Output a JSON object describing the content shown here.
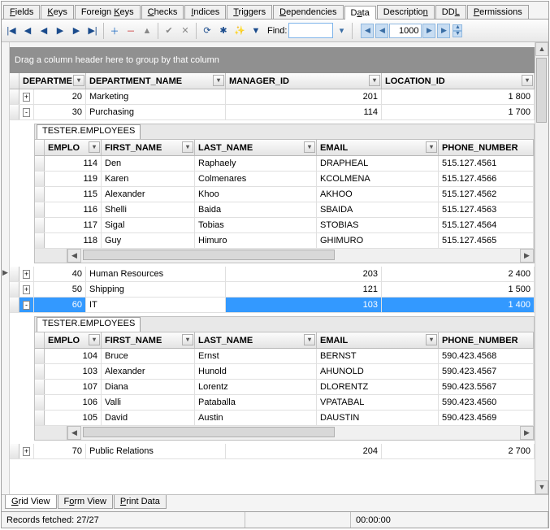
{
  "tabs": [
    "Fields",
    "Keys",
    "Foreign Keys",
    "Checks",
    "Indices",
    "Triggers",
    "Dependencies",
    "Data",
    "Description",
    "DDL",
    "Permissions"
  ],
  "active_tab": "Data",
  "toolbar": {
    "find_label": "Find:"
  },
  "nav": {
    "page_size": "1000"
  },
  "group_hint": "Drag a column header here to group by that column",
  "master": {
    "headers": [
      "DEPARTME",
      "DEPARTMENT_NAME",
      "MANAGER_ID",
      "LOCATION_ID"
    ],
    "rows": [
      {
        "expand": "+",
        "id": "20",
        "name": "Marketing",
        "manager": "201",
        "loc": "1 800",
        "selected": false,
        "expanded": false
      },
      {
        "expand": "-",
        "id": "30",
        "name": "Purchasing",
        "manager": "114",
        "loc": "1 700",
        "selected": false,
        "expanded": true
      },
      {
        "expand": "+",
        "id": "40",
        "name": "Human Resources",
        "manager": "203",
        "loc": "2 400",
        "selected": false,
        "expanded": false
      },
      {
        "expand": "+",
        "id": "50",
        "name": "Shipping",
        "manager": "121",
        "loc": "1 500",
        "selected": false,
        "expanded": false
      },
      {
        "expand": "-",
        "id": "60",
        "name": "IT",
        "manager": "103",
        "loc": "1 400",
        "selected": true,
        "expanded": true
      },
      {
        "expand": "+",
        "id": "70",
        "name": "Public Relations",
        "manager": "204",
        "loc": "2 700",
        "selected": false,
        "expanded": false
      }
    ]
  },
  "nested": {
    "tab_label": "TESTER.EMPLOYEES",
    "headers": [
      "EMPLO",
      "FIRST_NAME",
      "LAST_NAME",
      "EMAIL",
      "PHONE_NUMBER"
    ],
    "dept30": [
      {
        "id": "114",
        "first": "Den",
        "last": "Raphaely",
        "email": "DRAPHEAL",
        "phone": "515.127.4561"
      },
      {
        "id": "119",
        "first": "Karen",
        "last": "Colmenares",
        "email": "KCOLMENA",
        "phone": "515.127.4566"
      },
      {
        "id": "115",
        "first": "Alexander",
        "last": "Khoo",
        "email": "AKHOO",
        "phone": "515.127.4562"
      },
      {
        "id": "116",
        "first": "Shelli",
        "last": "Baida",
        "email": "SBAIDA",
        "phone": "515.127.4563"
      },
      {
        "id": "117",
        "first": "Sigal",
        "last": "Tobias",
        "email": "STOBIAS",
        "phone": "515.127.4564"
      },
      {
        "id": "118",
        "first": "Guy",
        "last": "Himuro",
        "email": "GHIMURO",
        "phone": "515.127.4565"
      }
    ],
    "dept60": [
      {
        "id": "104",
        "first": "Bruce",
        "last": "Ernst",
        "email": "BERNST",
        "phone": "590.423.4568"
      },
      {
        "id": "103",
        "first": "Alexander",
        "last": "Hunold",
        "email": "AHUNOLD",
        "phone": "590.423.4567"
      },
      {
        "id": "107",
        "first": "Diana",
        "last": "Lorentz",
        "email": "DLORENTZ",
        "phone": "590.423.5567"
      },
      {
        "id": "106",
        "first": "Valli",
        "last": "Pataballa",
        "email": "VPATABAL",
        "phone": "590.423.4560"
      },
      {
        "id": "105",
        "first": "David",
        "last": "Austin",
        "email": "DAUSTIN",
        "phone": "590.423.4569"
      }
    ]
  },
  "bottom_tabs": [
    "Grid View",
    "Form View",
    "Print Data"
  ],
  "bottom_active": "Grid View",
  "status": {
    "records": "Records fetched: 27/27",
    "time": "00:00:00"
  },
  "icons": {
    "first": "|◀",
    "prev": "◀",
    "pp": "◀",
    "next": "▶",
    "nn": "▶",
    "last": "▶|",
    "plus": "＋",
    "minus": "－",
    "sep": "▲",
    "check": "✔",
    "x": "✕",
    "refresh": "⟳",
    "star": "✱",
    "wand": "✨",
    "filter": "▼",
    "dd": "▾",
    "navfirst": "◀",
    "navlast": "▶",
    "up": "▲",
    "dn": "▼"
  }
}
